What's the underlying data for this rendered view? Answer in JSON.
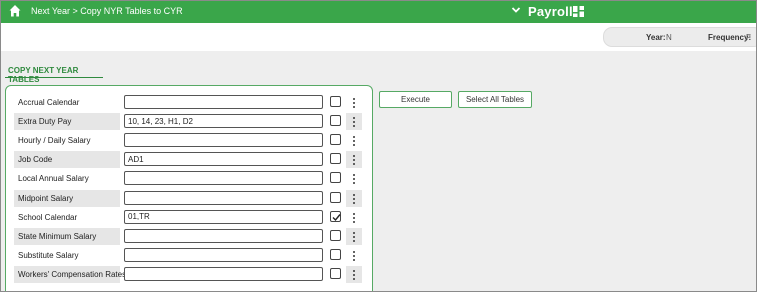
{
  "topbar": {
    "breadcrumb": "Next Year > Copy NYR Tables to CYR",
    "app_name": "Payroll",
    "home_icon": "home-icon",
    "menu_icon": "chevron-down-icon",
    "apps_icon": "grid-icon"
  },
  "status": {
    "year_label": "Year:",
    "year_value": "N",
    "frequency_label": "Frequency:",
    "frequency_value": "F"
  },
  "section": {
    "title": "COPY NEXT YEAR TABLES"
  },
  "tables": [
    {
      "label": "Accrual Calendar",
      "value": "",
      "checked": false
    },
    {
      "label": "Extra Duty Pay",
      "value": "10, 14, 23, H1, D2",
      "checked": false
    },
    {
      "label": "Hourly / Daily Salary",
      "value": "",
      "checked": false
    },
    {
      "label": "Job Code",
      "value": "AD1",
      "checked": false
    },
    {
      "label": "Local Annual Salary",
      "value": "",
      "checked": false
    },
    {
      "label": "Midpoint Salary",
      "value": "",
      "checked": false
    },
    {
      "label": "School Calendar",
      "value": "01,TR",
      "checked": true
    },
    {
      "label": "State Minimum Salary",
      "value": "",
      "checked": false
    },
    {
      "label": "Substitute Salary",
      "value": "",
      "checked": false
    },
    {
      "label": "Workers' Compensation Rates",
      "value": "",
      "checked": false
    }
  ],
  "buttons": {
    "execute": "Execute",
    "select_all": "Select All Tables"
  },
  "colors": {
    "brand_green": "#3aa64a",
    "accent_green": "#2f8a3e"
  }
}
